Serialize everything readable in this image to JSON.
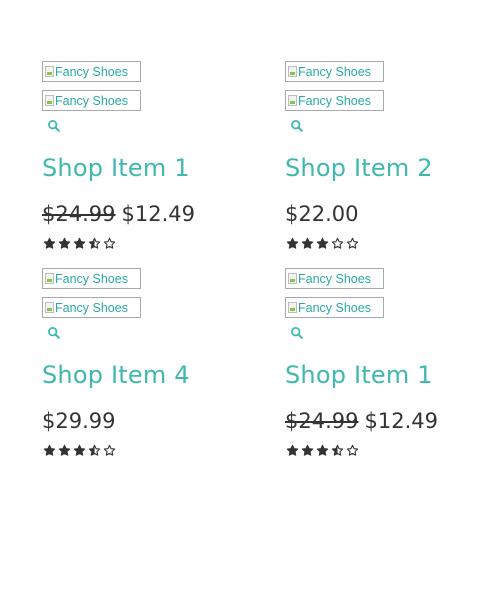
{
  "products": [
    {
      "images": [
        "Fancy Shoes",
        "Fancy Shoes"
      ],
      "title": "Shop Item 1",
      "old_price": "$24.99",
      "price": "$12.49",
      "rating": 3.5
    },
    {
      "images": [
        "Fancy Shoes",
        "Fancy Shoes"
      ],
      "title": "Shop Item 2",
      "old_price": "",
      "price": "$22.00",
      "rating": 3
    },
    {
      "images": [
        "Fancy Shoes",
        "Fancy Shoes"
      ],
      "title": "Shop Item 4",
      "old_price": "",
      "price": "$29.99",
      "rating": 3.5
    },
    {
      "images": [
        "Fancy Shoes",
        "Fancy Shoes"
      ],
      "title": "Shop Item 1",
      "old_price": "$24.99",
      "price": "$12.49",
      "rating": 3.5
    }
  ],
  "icons": {
    "quick_view": "search-icon",
    "star_full": "star-icon",
    "star_half": "star-half-icon",
    "star_empty": "star-outline-icon"
  },
  "colors": {
    "accent": "#3fb8af",
    "text": "#333333",
    "broken_image_border": "#a9a9a9"
  }
}
